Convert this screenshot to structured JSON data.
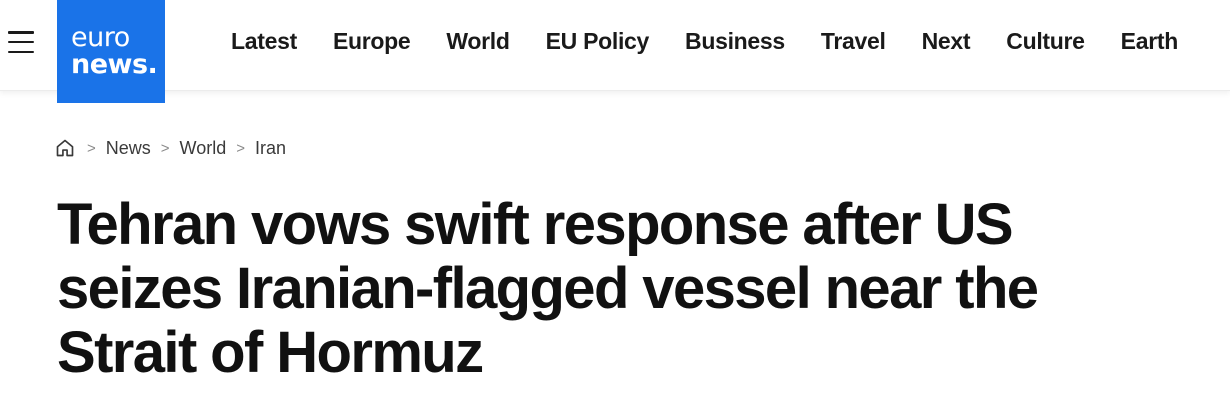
{
  "header": {
    "logo": {
      "line1": "euro",
      "line2": "news.",
      "color": "#1a73e8"
    },
    "nav": [
      "Latest",
      "Europe",
      "World",
      "EU Policy",
      "Business",
      "Travel",
      "Next",
      "Culture",
      "Earth"
    ]
  },
  "breadcrumb": {
    "home_icon": "home-icon",
    "items": [
      "News",
      "World",
      "Iran"
    ]
  },
  "article": {
    "title": "Tehran vows swift response after US seizes Iranian-flagged vessel near the Strait of Hormuz"
  }
}
